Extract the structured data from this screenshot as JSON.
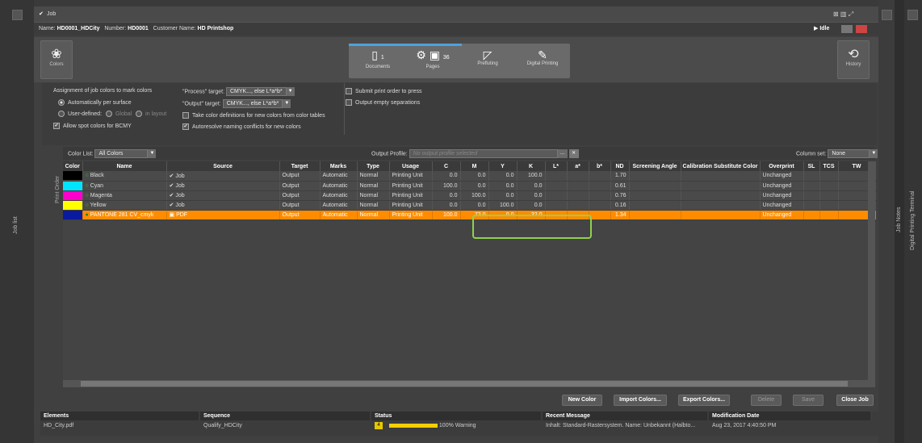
{
  "window": {
    "title": "Job"
  },
  "job_info": {
    "name_label": "Name:",
    "name": "HD0001_HDCity",
    "number_label": "Number:",
    "number": "HD0001",
    "customer_label": "Customer Name:",
    "customer": "HD Printshop",
    "status": "Idle"
  },
  "toolbar": {
    "colors_label": "Colors",
    "history_label": "History"
  },
  "workflow": {
    "steps": [
      {
        "label": "Documents",
        "count": "1"
      },
      {
        "label": "Pages",
        "count": "36"
      },
      {
        "label": "Prefluting"
      },
      {
        "label": "Digital Printing"
      }
    ]
  },
  "config": {
    "assignment_title": "Assignment of job colors to mark colors",
    "auto_surface": "Automatically per surface",
    "user_defined": "User-defined:",
    "global": "Global",
    "in_layout": "in layout",
    "allow_spot": "Allow spot colors for BCMY",
    "process_target_label": "\"Process\" target:",
    "process_target_value": "CMYK..., else L*a*b*",
    "output_target_label": "\"Output\" target:",
    "output_target_value": "CMYK..., else L*a*b*",
    "take_color_defs": "Take color definitions for new colors from color tables",
    "autoresolve": "Autoresolve naming conflicts for new colors",
    "submit_print": "Submit print order to press",
    "output_empty": "Output empty separations"
  },
  "colorlist": {
    "label": "Color List:",
    "value": "All Colors",
    "output_profile_label": "Output Profile:",
    "output_profile_placeholder": "No output profile selected",
    "column_set_label": "Column set:",
    "column_set_value": "None",
    "print_order": "Print Order"
  },
  "table": {
    "headers": [
      "Color",
      "Name",
      "Source",
      "Target",
      "Marks",
      "Type",
      "Usage",
      "C",
      "M",
      "Y",
      "K",
      "L*",
      "a*",
      "b*",
      "ND",
      "Screening Angle",
      "Calibration Substitute Color",
      "Overprint",
      "SL",
      "TCS",
      "TW"
    ],
    "rows": [
      {
        "swatch": "#000000",
        "name": "Black",
        "source": "Job",
        "target": "Output",
        "marks": "Automatic",
        "type": "Normal",
        "usage": "Printing Unit",
        "c": "0.0",
        "m": "0.0",
        "y": "0.0",
        "k": "100.0",
        "nd": "1.70",
        "overprint": "Unchanged"
      },
      {
        "swatch": "#00e5ff",
        "name": "Cyan",
        "source": "Job",
        "target": "Output",
        "marks": "Automatic",
        "type": "Normal",
        "usage": "Printing Unit",
        "c": "100.0",
        "m": "0.0",
        "y": "0.0",
        "k": "0.0",
        "nd": "0.61",
        "overprint": "Unchanged"
      },
      {
        "swatch": "#ff00cc",
        "name": "Magenta",
        "source": "Job",
        "target": "Output",
        "marks": "Automatic",
        "type": "Normal",
        "usage": "Printing Unit",
        "c": "0.0",
        "m": "100.0",
        "y": "0.0",
        "k": "0.0",
        "nd": "0.76",
        "overprint": "Unchanged"
      },
      {
        "swatch": "#ffff00",
        "name": "Yellow",
        "source": "Job",
        "target": "Output",
        "marks": "Automatic",
        "type": "Normal",
        "usage": "Printing Unit",
        "c": "0.0",
        "m": "0.0",
        "y": "100.0",
        "k": "0.0",
        "nd": "0.16",
        "overprint": "Unchanged"
      },
      {
        "swatch": "#0a1a9e",
        "name": "PANTONE 281 CV_cmyk",
        "source": "PDF",
        "target": "Output",
        "marks": "Automatic",
        "type": "Normal",
        "usage": "Printing Unit",
        "c": "100.0",
        "m": "72.0",
        "y": "0.0",
        "k": "32.0",
        "nd": "1.34",
        "overprint": "Unchanged"
      }
    ]
  },
  "buttons": {
    "new_color": "New Color",
    "import_colors": "Import Colors...",
    "export_colors": "Export Colors...",
    "delete": "Delete",
    "save": "Save",
    "close_job": "Close Job"
  },
  "bottom": {
    "headers": {
      "elements": "Elements",
      "sequence": "Sequence",
      "status": "Status",
      "recent": "Recent Message",
      "modified": "Modification Date"
    },
    "row": {
      "elements": "HD_City.pdf",
      "sequence": "Qualify_HDCity",
      "status_badge": "4",
      "progress": "100%",
      "status_text": "Warning",
      "recent": "Inhalt: Standard-Rastersystem. Name: Unbekannt (Halbto...",
      "modified": "Aug 23, 2017 4:40:50 PM"
    },
    "progress_fraction": 1.0
  },
  "side": {
    "left_label": "Job list",
    "right_label_1": "Job Notes",
    "right_label_2": "Digital Printing Terminal"
  },
  "colors": {
    "accent_orange": "#ff8c00",
    "highlight_green": "#8fd14f"
  }
}
